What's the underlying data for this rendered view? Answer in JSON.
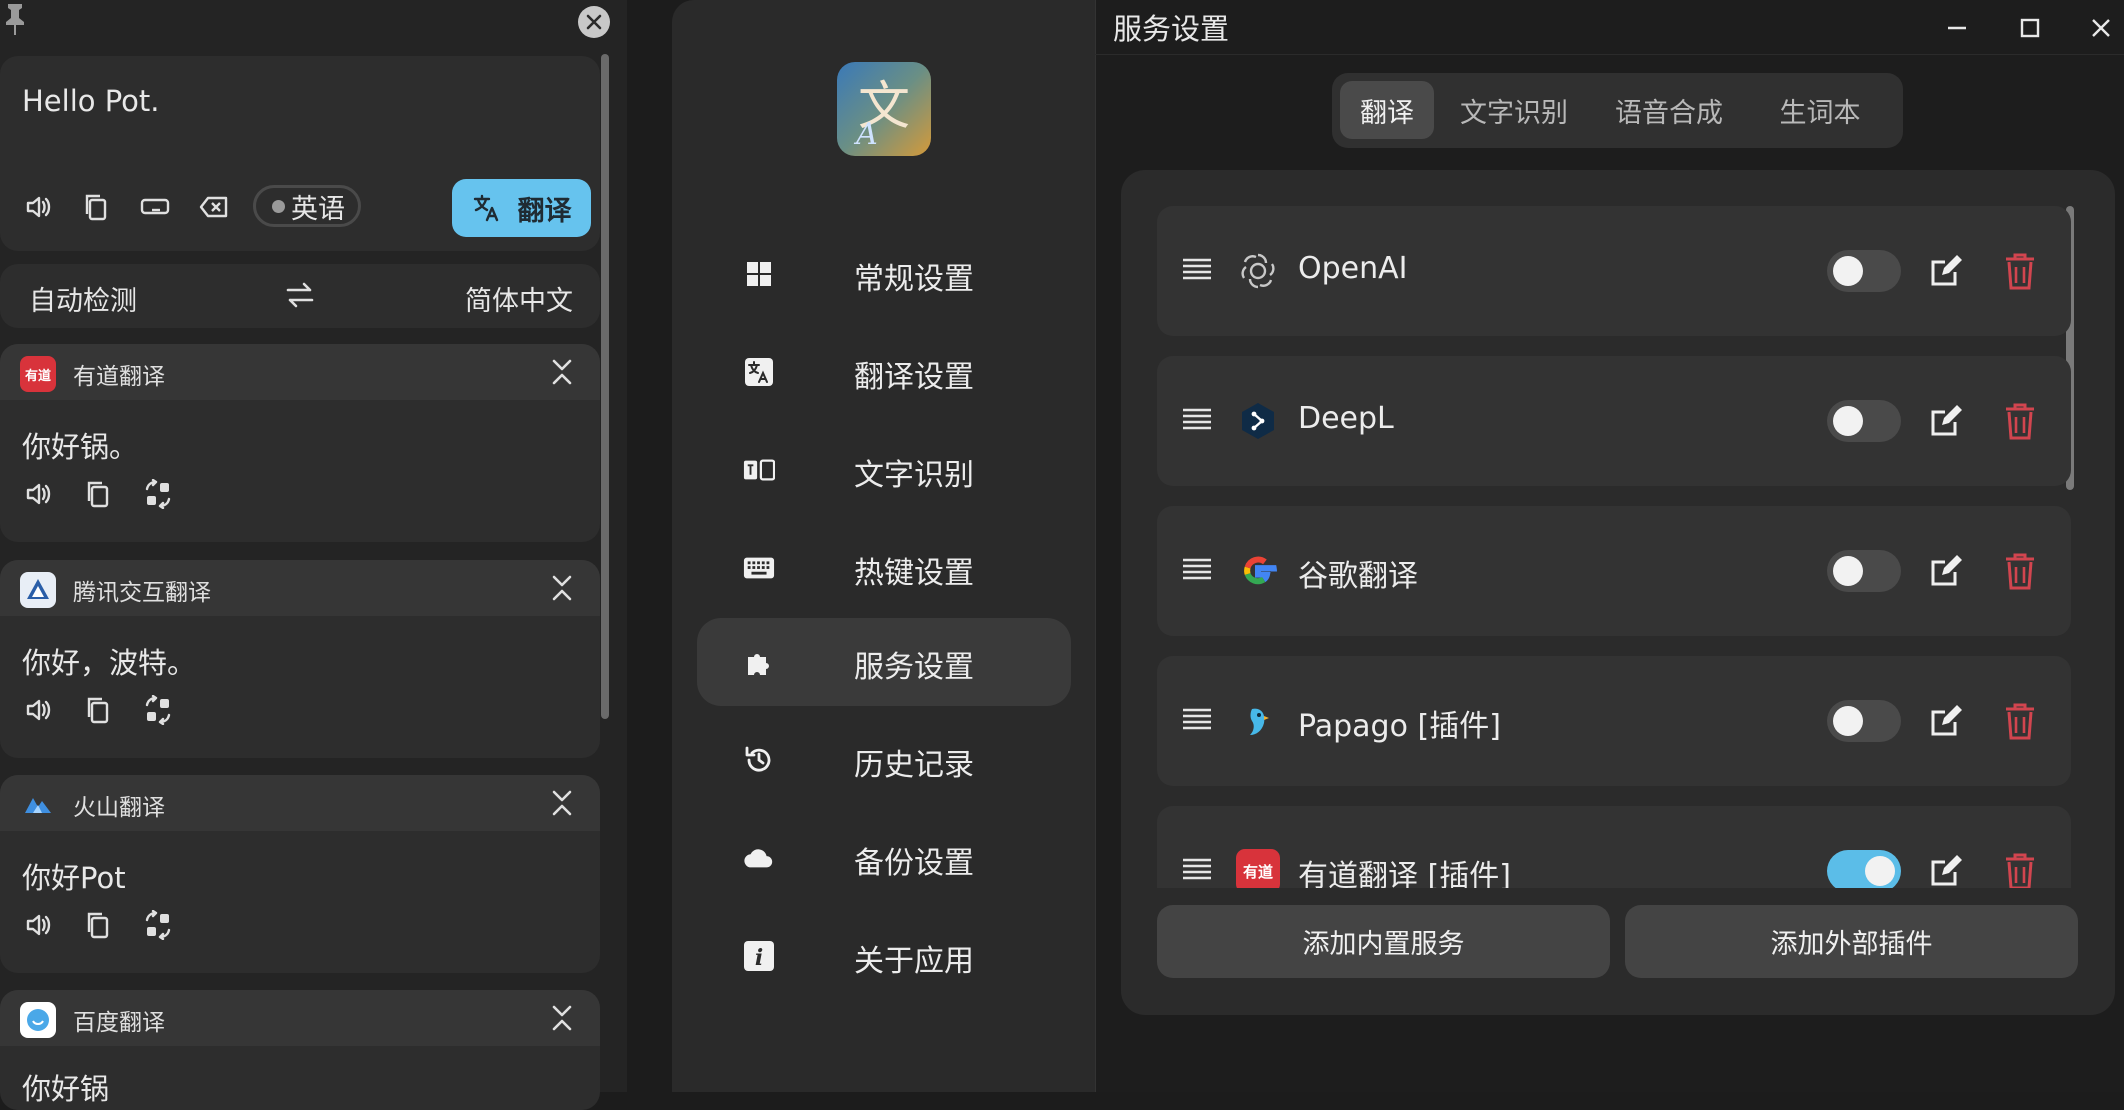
{
  "translator": {
    "input_text": "Hello Pot.",
    "detected_language": "英语",
    "translate_button": "翻译",
    "source_language": "自动检测",
    "target_language": "简体中文",
    "services": [
      {
        "name": "有道翻译",
        "result": "你好锅。",
        "logo_text": "有道"
      },
      {
        "name": "腾讯交互翻译",
        "result": "你好，波特。"
      },
      {
        "name": "火山翻译",
        "result": "你好Pot"
      },
      {
        "name": "百度翻译",
        "result": "你好锅"
      }
    ]
  },
  "sidebar": {
    "items": [
      {
        "label": "常规设置",
        "icon": "grid-icon"
      },
      {
        "label": "翻译设置",
        "icon": "translate-icon"
      },
      {
        "label": "文字识别",
        "icon": "ocr-icon"
      },
      {
        "label": "热键设置",
        "icon": "keyboard-icon"
      },
      {
        "label": "服务设置",
        "icon": "puzzle-icon",
        "active": true
      },
      {
        "label": "历史记录",
        "icon": "history-icon"
      },
      {
        "label": "备份设置",
        "icon": "cloud-icon"
      },
      {
        "label": "关于应用",
        "icon": "info-icon"
      }
    ]
  },
  "window": {
    "title": "服务设置"
  },
  "tabs": [
    {
      "label": "翻译",
      "active": true
    },
    {
      "label": "文字识别"
    },
    {
      "label": "语音合成"
    },
    {
      "label": "生词本"
    }
  ],
  "service_list": [
    {
      "name": "OpenAI",
      "enabled": false,
      "icon": "openai-icon"
    },
    {
      "name": "DeepL",
      "enabled": false,
      "icon": "deepl-icon"
    },
    {
      "name": "谷歌翻译",
      "enabled": false,
      "icon": "google-icon"
    },
    {
      "name": "Papago [插件]",
      "enabled": false,
      "icon": "papago-icon"
    },
    {
      "name": "有道翻译 [插件]",
      "enabled": true,
      "icon": "youdao-icon",
      "logo_text": "有道"
    }
  ],
  "buttons": {
    "add_builtin": "添加内置服务",
    "add_plugin": "添加外部插件"
  },
  "colors": {
    "accent": "#66c3ee",
    "toggle_on": "#5bbde8",
    "danger": "#d2454f",
    "youdao_red": "#d8333b"
  }
}
